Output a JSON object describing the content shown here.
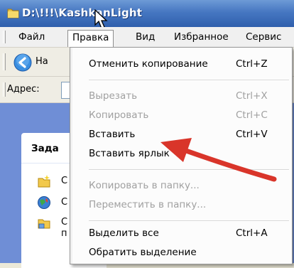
{
  "window": {
    "title": "D:\\!!!\\KashkanLight",
    "folder_icon": "folder-icon",
    "accent": "#2f5fad"
  },
  "menubar": {
    "items": [
      {
        "label": "Файл"
      },
      {
        "label": "Правка",
        "active": true
      },
      {
        "label": "Вид"
      },
      {
        "label": "Избранное"
      },
      {
        "label": "Сервис"
      }
    ]
  },
  "toolbar": {
    "back_label": "На",
    "back_icon": "back-arrow-icon"
  },
  "addressbar": {
    "label": "Адрес:",
    "value": ""
  },
  "taskpane": {
    "header": "Зада",
    "tasks": [
      {
        "icon": "new-folder-icon",
        "text": "С"
      },
      {
        "icon": "globe-icon",
        "text": "С"
      },
      {
        "icon": "share-folder-icon",
        "text": "С",
        "text2": "п"
      }
    ],
    "background": "#6f8ed6"
  },
  "edit_menu": {
    "items": [
      {
        "label": "Отменить копирование",
        "shortcut": "Ctrl+Z",
        "enabled": true
      },
      {
        "label": "Вырезать",
        "shortcut": "Ctrl+X",
        "enabled": false
      },
      {
        "label": "Копировать",
        "shortcut": "Ctrl+C",
        "enabled": false
      },
      {
        "label": "Вставить",
        "shortcut": "Ctrl+V",
        "enabled": true
      },
      {
        "label": "Вставить ярлык",
        "shortcut": "",
        "enabled": true
      },
      {
        "label": "Копировать в папку...",
        "shortcut": "",
        "enabled": false
      },
      {
        "label": "Переместить в папку...",
        "shortcut": "",
        "enabled": false
      },
      {
        "label": "Выделить все",
        "shortcut": "Ctrl+A",
        "enabled": true
      },
      {
        "label": "Обратить выделение",
        "shortcut": "",
        "enabled": true
      }
    ]
  },
  "annotation": {
    "arrow_color": "#d9352a",
    "points_to": "Вставить"
  }
}
